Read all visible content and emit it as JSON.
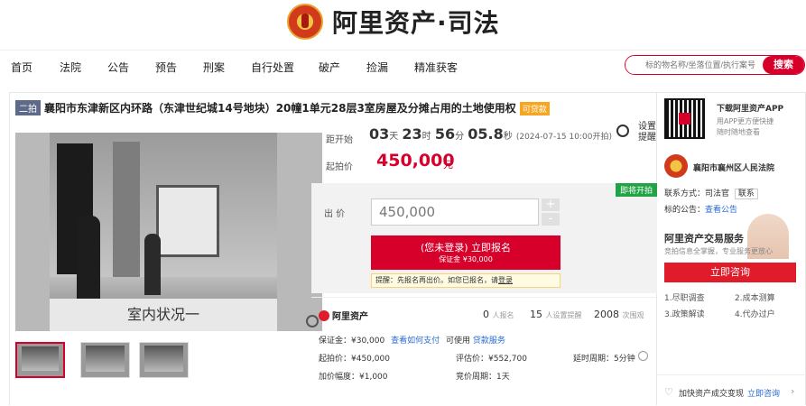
{
  "header": {
    "brand": "阿里资产·司法"
  },
  "nav": {
    "items": [
      "首页",
      "法院",
      "公告",
      "预告",
      "刑案",
      "自行处置",
      "破产",
      "捡漏",
      "精准获客"
    ],
    "search_placeholder": "标的物名称/坐落位置/执行案号",
    "search_button": "搜索"
  },
  "auction": {
    "round": "二拍",
    "title": "襄阳市东津新区内环路（东津世纪城14号地块）20幢1单元28层3室房屋及分摊占用的土地使用权",
    "loan_tag": "可贷款",
    "countdown_label": "距开始",
    "countdown": {
      "days": "03",
      "d_unit": "天",
      "hours": "23",
      "h_unit": "时",
      "minutes": "56",
      "m_unit": "分",
      "seconds": "05.8",
      "s_unit": "秒"
    },
    "start_time": "(2024-07-15 10:00开拍)",
    "reminder": "设置提醒",
    "start_price_label": "起拍价",
    "start_price": "450,000",
    "price_unit": "元",
    "photo_caption": "室内状况一",
    "status_badge": "即将开拍",
    "bid_label": "出 价",
    "bid_value": "450,000",
    "plus": "+",
    "minus": "-",
    "enroll_line1": "(您未登录) 立即报名",
    "enroll_line2": "保证金 ¥30,000",
    "hint_prefix": "提醒：先报名再出价。如您已报名，请",
    "hint_link": "登录"
  },
  "stats": {
    "logo": "阿里资产",
    "enroll_count": "0",
    "enroll_label": "人报名",
    "remind_count": "15",
    "remind_label": "人设置提醒",
    "view_count": "2008",
    "view_label": "次围观",
    "deposit": "保证金：¥30,000",
    "deposit_link": "查看如何支付",
    "loan_text": "可使用",
    "loan_link": "贷款服务",
    "start_price": "起拍价：¥450,000",
    "assess": "评估价：¥552,700",
    "delay": "延时周期：5分钟",
    "increment": "加价幅度：¥1,000",
    "period": "竞价周期：1天"
  },
  "sidebar": {
    "app_title": "下载阿里资产APP",
    "app_desc1": "用APP更方便快捷",
    "app_desc2": "随时随地查看",
    "court": "襄阳市襄州区人民法院",
    "contact_label": "联系方式：",
    "contact_name": "司法官",
    "contact_btn": "联系",
    "notice_label": "标的公告：",
    "notice_link": "查看公告",
    "service_title": "阿里资产交易服务",
    "service_desc": "竞拍信息全掌握，专业服务更放心",
    "consult_btn": "立即咨询",
    "services": [
      "1.尽职调查",
      "2.成本测算",
      "3.政策解读",
      "4.代办过户"
    ],
    "footer_text": "加快资产成交变现",
    "footer_link": "立即咨询"
  }
}
